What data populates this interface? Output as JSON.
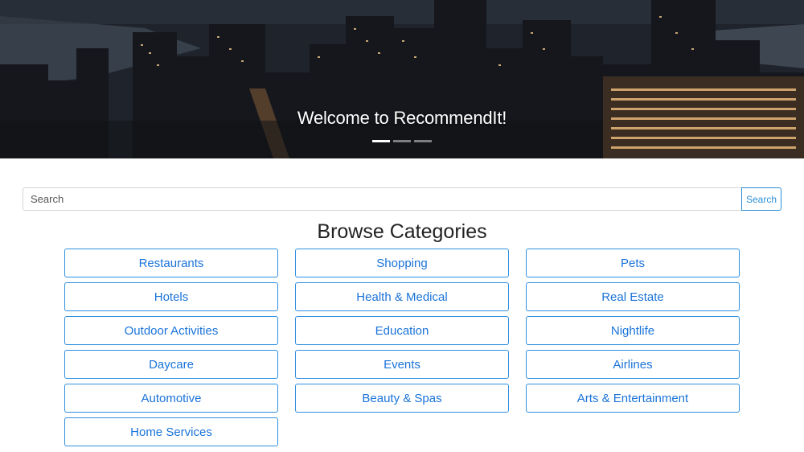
{
  "hero": {
    "title": "Welcome to RecommendIt!",
    "indicators": [
      {
        "active": true
      },
      {
        "active": false
      },
      {
        "active": false
      }
    ]
  },
  "search": {
    "placeholder": "Search",
    "button_label": "Search"
  },
  "categories": {
    "title": "Browse Categories",
    "items": [
      "Restaurants",
      "Shopping",
      "Pets",
      "Hotels",
      "Health & Medical",
      "Real Estate",
      "Outdoor Activities",
      "Education",
      "Nightlife",
      "Daycare",
      "Events",
      "Airlines",
      "Automotive",
      "Beauty & Spas",
      "Arts & Entertainment",
      "Home Services"
    ]
  },
  "colors": {
    "accent": "#1a73d9",
    "button_border": "#2f8fe0"
  }
}
